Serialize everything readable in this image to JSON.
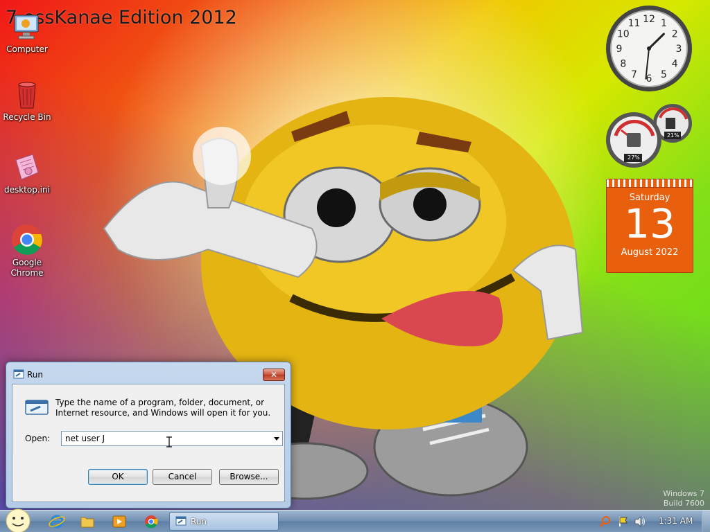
{
  "desktop": {
    "banner": "7 ossKanae Edition 2012",
    "icons": [
      {
        "label": "Computer",
        "icon": "computer-icon"
      },
      {
        "label": "Recycle Bin",
        "icon": "recycle-bin-icon"
      },
      {
        "label": "desktop.ini",
        "icon": "settings-file-icon"
      },
      {
        "label": "Google\nChrome",
        "icon": "chrome-icon"
      }
    ],
    "watermark_line1": "Windows 7",
    "watermark_line2": "Build 7600"
  },
  "gadgets": {
    "clock": {
      "icon": "analog-clock-icon",
      "numerals": [
        "12",
        "1",
        "2",
        "3",
        "4",
        "5",
        "6",
        "7",
        "8",
        "9",
        "10",
        "11"
      ],
      "hour": 1,
      "minute": 31
    },
    "cpu_meter": {
      "cpu_percent": "27%",
      "memory_percent": "21%"
    },
    "calendar": {
      "weekday": "Saturday",
      "day": "13",
      "month_year": "August 2022"
    }
  },
  "run_dialog": {
    "title": "Run",
    "close_label": "✕",
    "message": "Type the name of a program, folder, document, or Internet resource, and Windows will open it for you.",
    "open_label": "Open:",
    "open_value": "net user J",
    "ok_label": "OK",
    "cancel_label": "Cancel",
    "browse_label": "Browse..."
  },
  "taskbar": {
    "start_icon": "smiley-start-icon",
    "pinned": [
      "internet-explorer-icon",
      "folder-icon",
      "media-player-icon",
      "chrome-icon"
    ],
    "active_window_label": "Run",
    "time": "1:31 AM"
  },
  "colors": {
    "calendar_bg": "#e8600e",
    "taskbar": "#6f8eb0",
    "close_red": "#c9533c"
  }
}
